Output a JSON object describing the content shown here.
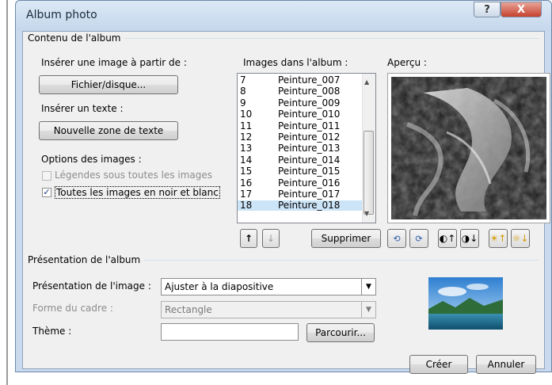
{
  "window": {
    "title": "Album photo",
    "help_glyph": "?",
    "close_glyph": "X"
  },
  "album_content": {
    "group_label": "Contenu de l'album",
    "insert_image_label": "Insérer une image à partir de :",
    "file_button": "Fichier/disque...",
    "insert_text_label": "Insérer un texte :",
    "new_textbox_button": "Nouvelle zone de texte",
    "image_options_label": "Options des images :",
    "captions_option": {
      "label": "Légendes sous toutes les images",
      "checked": false,
      "enabled": false
    },
    "bw_option": {
      "label": "Toutes les images en noir et blanc",
      "checked": true,
      "enabled": true
    },
    "images_label": "Images dans l'album :",
    "images": [
      {
        "num": "7",
        "name": "Peinture_007"
      },
      {
        "num": "8",
        "name": "Peinture_008"
      },
      {
        "num": "9",
        "name": "Peinture_009"
      },
      {
        "num": "10",
        "name": "Peinture_010"
      },
      {
        "num": "11",
        "name": "Peinture_011"
      },
      {
        "num": "12",
        "name": "Peinture_012"
      },
      {
        "num": "13",
        "name": "Peinture_013"
      },
      {
        "num": "14",
        "name": "Peinture_014"
      },
      {
        "num": "15",
        "name": "Peinture_015"
      },
      {
        "num": "16",
        "name": "Peinture_016"
      },
      {
        "num": "17",
        "name": "Peinture_017"
      },
      {
        "num": "18",
        "name": "Peinture_018"
      }
    ],
    "selected_image": "18",
    "move_up_glyph": "↑",
    "move_down_glyph": "↓",
    "delete_button": "Supprimer",
    "preview_label": "Aperçu :"
  },
  "album_layout": {
    "group_label": "Présentation de l'album",
    "image_layout_label": "Présentation de l'image :",
    "image_layout_value": "Ajuster à la diapositive",
    "frame_shape_label": "Forme du cadre :",
    "frame_shape_value": "Rectangle",
    "theme_label": "Thème :",
    "theme_value": "",
    "browse_button": "Parcourir..."
  },
  "footer": {
    "create_button": "Créer",
    "cancel_button": "Annuler"
  },
  "colors": {
    "title_bar": "#c5d7ec",
    "close_button": "#c6422e",
    "selection": "#cce4f7"
  }
}
